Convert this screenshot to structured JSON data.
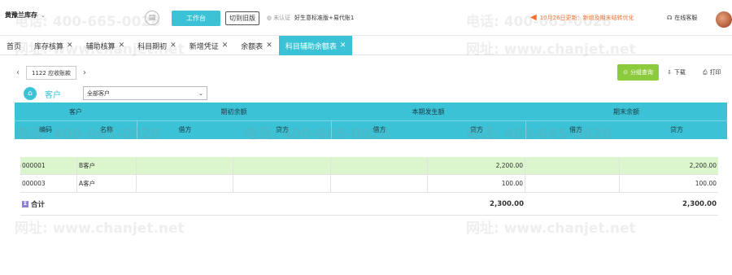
{
  "topbar": {
    "company": "黄豫兰库存",
    "workbench_label": "工作台",
    "switch_old_label": "切到旧版",
    "verify_text": "未认证",
    "edition_text": "好生意标准版+易代账1",
    "notice_text": "10月26日更新：新增及期末结转优化",
    "service_label": "在线客服"
  },
  "tabs": [
    {
      "label": "首页",
      "closable": false,
      "active": false
    },
    {
      "label": "库存核算",
      "closable": true,
      "active": false
    },
    {
      "label": "辅助核算",
      "closable": true,
      "active": false
    },
    {
      "label": "科目期初",
      "closable": true,
      "active": false
    },
    {
      "label": "新增凭证",
      "closable": true,
      "active": false
    },
    {
      "label": "余额表",
      "closable": true,
      "active": false
    },
    {
      "label": "科目辅助余额表",
      "closable": true,
      "active": true
    }
  ],
  "toolbar": {
    "subject": "1122  应收账款",
    "query_label": "分组查询",
    "download_label": "下载",
    "print_label": "打印"
  },
  "filter": {
    "customer_label": "客户",
    "customer_value": "全部客户"
  },
  "table": {
    "group_headers": {
      "customer": "客户",
      "opening": "期初余额",
      "period": "本期发生额",
      "closing": "期末余额"
    },
    "sub_headers": [
      "编码",
      "名称",
      "借方",
      "贷方",
      "借方",
      "贷方",
      "借方",
      "贷方"
    ],
    "rows": [
      {
        "code": "000001",
        "name": "B客户",
        "open_debit": "",
        "open_credit": "",
        "period_debit": "2,200.00",
        "period_credit": "",
        "close_debit": "2,200.00",
        "close_credit": "",
        "highlight": true
      },
      {
        "code": "000003",
        "name": "A客户",
        "open_debit": "",
        "open_credit": "",
        "period_debit": "100.00",
        "period_credit": "",
        "close_debit": "100.00",
        "close_credit": "",
        "highlight": false
      }
    ],
    "total": {
      "label": "合计",
      "period_debit": "2,300.00",
      "close_debit": "2,300.00"
    }
  },
  "watermark": {
    "phone": "电话: 400-665-0028",
    "site": "网址: www.chanjet.net"
  },
  "colors": {
    "accent": "#3cc2d6",
    "query_button": "#8ccb3e",
    "row_highlight": "#dbf5cd",
    "notice": "#f0763a"
  }
}
